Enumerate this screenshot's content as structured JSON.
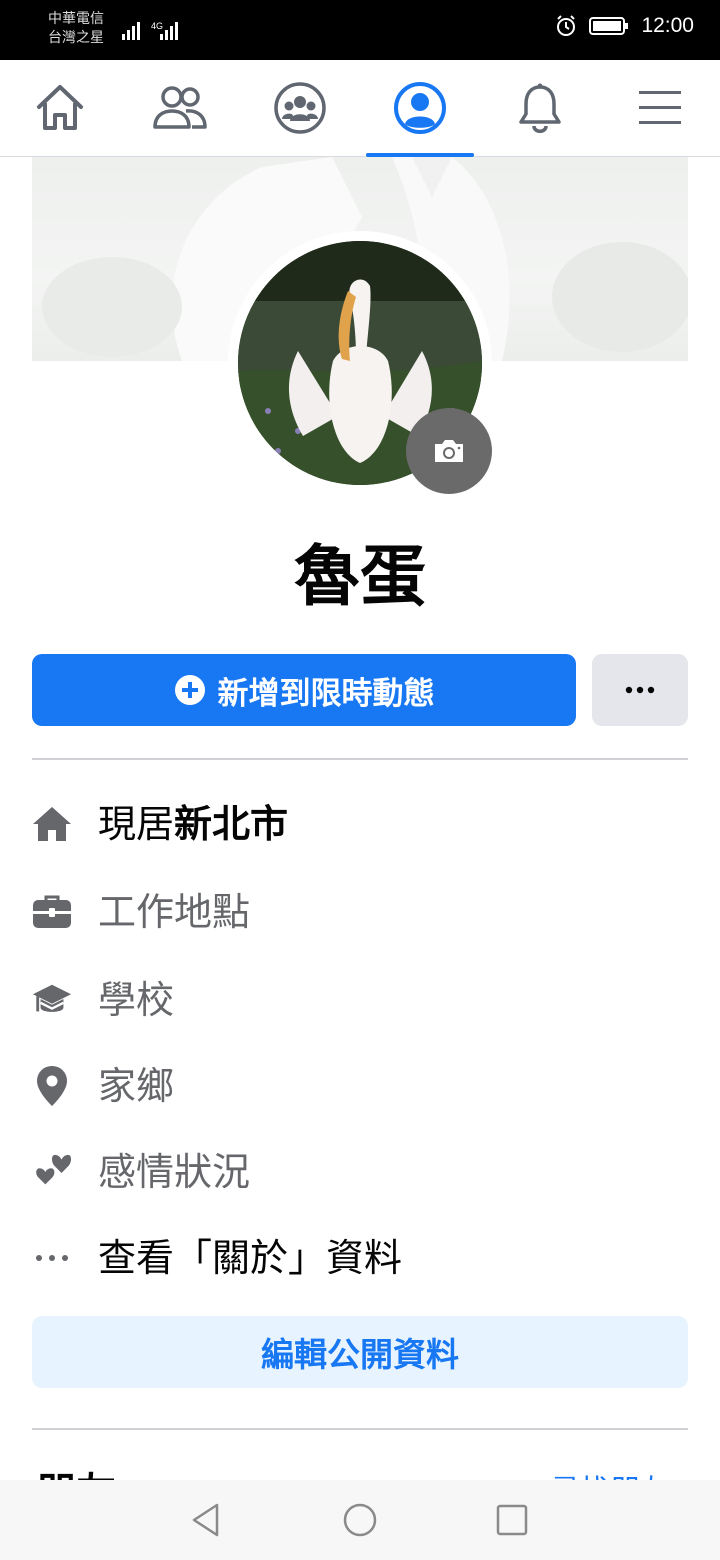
{
  "status_bar": {
    "carrier_line1": "中華電信",
    "carrier_line2": "台灣之星",
    "network": "4G",
    "time": "12:00"
  },
  "nav": {
    "tabs": [
      {
        "name": "home",
        "icon": "home-icon"
      },
      {
        "name": "friends",
        "icon": "friends-icon"
      },
      {
        "name": "groups",
        "icon": "groups-icon"
      },
      {
        "name": "profile",
        "icon": "profile-icon",
        "active": true
      },
      {
        "name": "notifications",
        "icon": "bell-icon"
      },
      {
        "name": "menu",
        "icon": "hamburger-menu-icon"
      }
    ],
    "accent_color": "#1877f2"
  },
  "profile": {
    "name": "魯蛋"
  },
  "actions": {
    "add_story_label": "新增到限時動態",
    "more_label": "•••"
  },
  "intro": {
    "current_city_prefix": "現居",
    "current_city": "新北市",
    "workplace": "工作地點",
    "school": "學校",
    "hometown": "家鄉",
    "relationship": "感情狀況",
    "see_about": "查看「關於」資料"
  },
  "edit_profile_label": "編輯公開資料",
  "next_section": {
    "title": "朋友",
    "link": "尋找朋友"
  }
}
